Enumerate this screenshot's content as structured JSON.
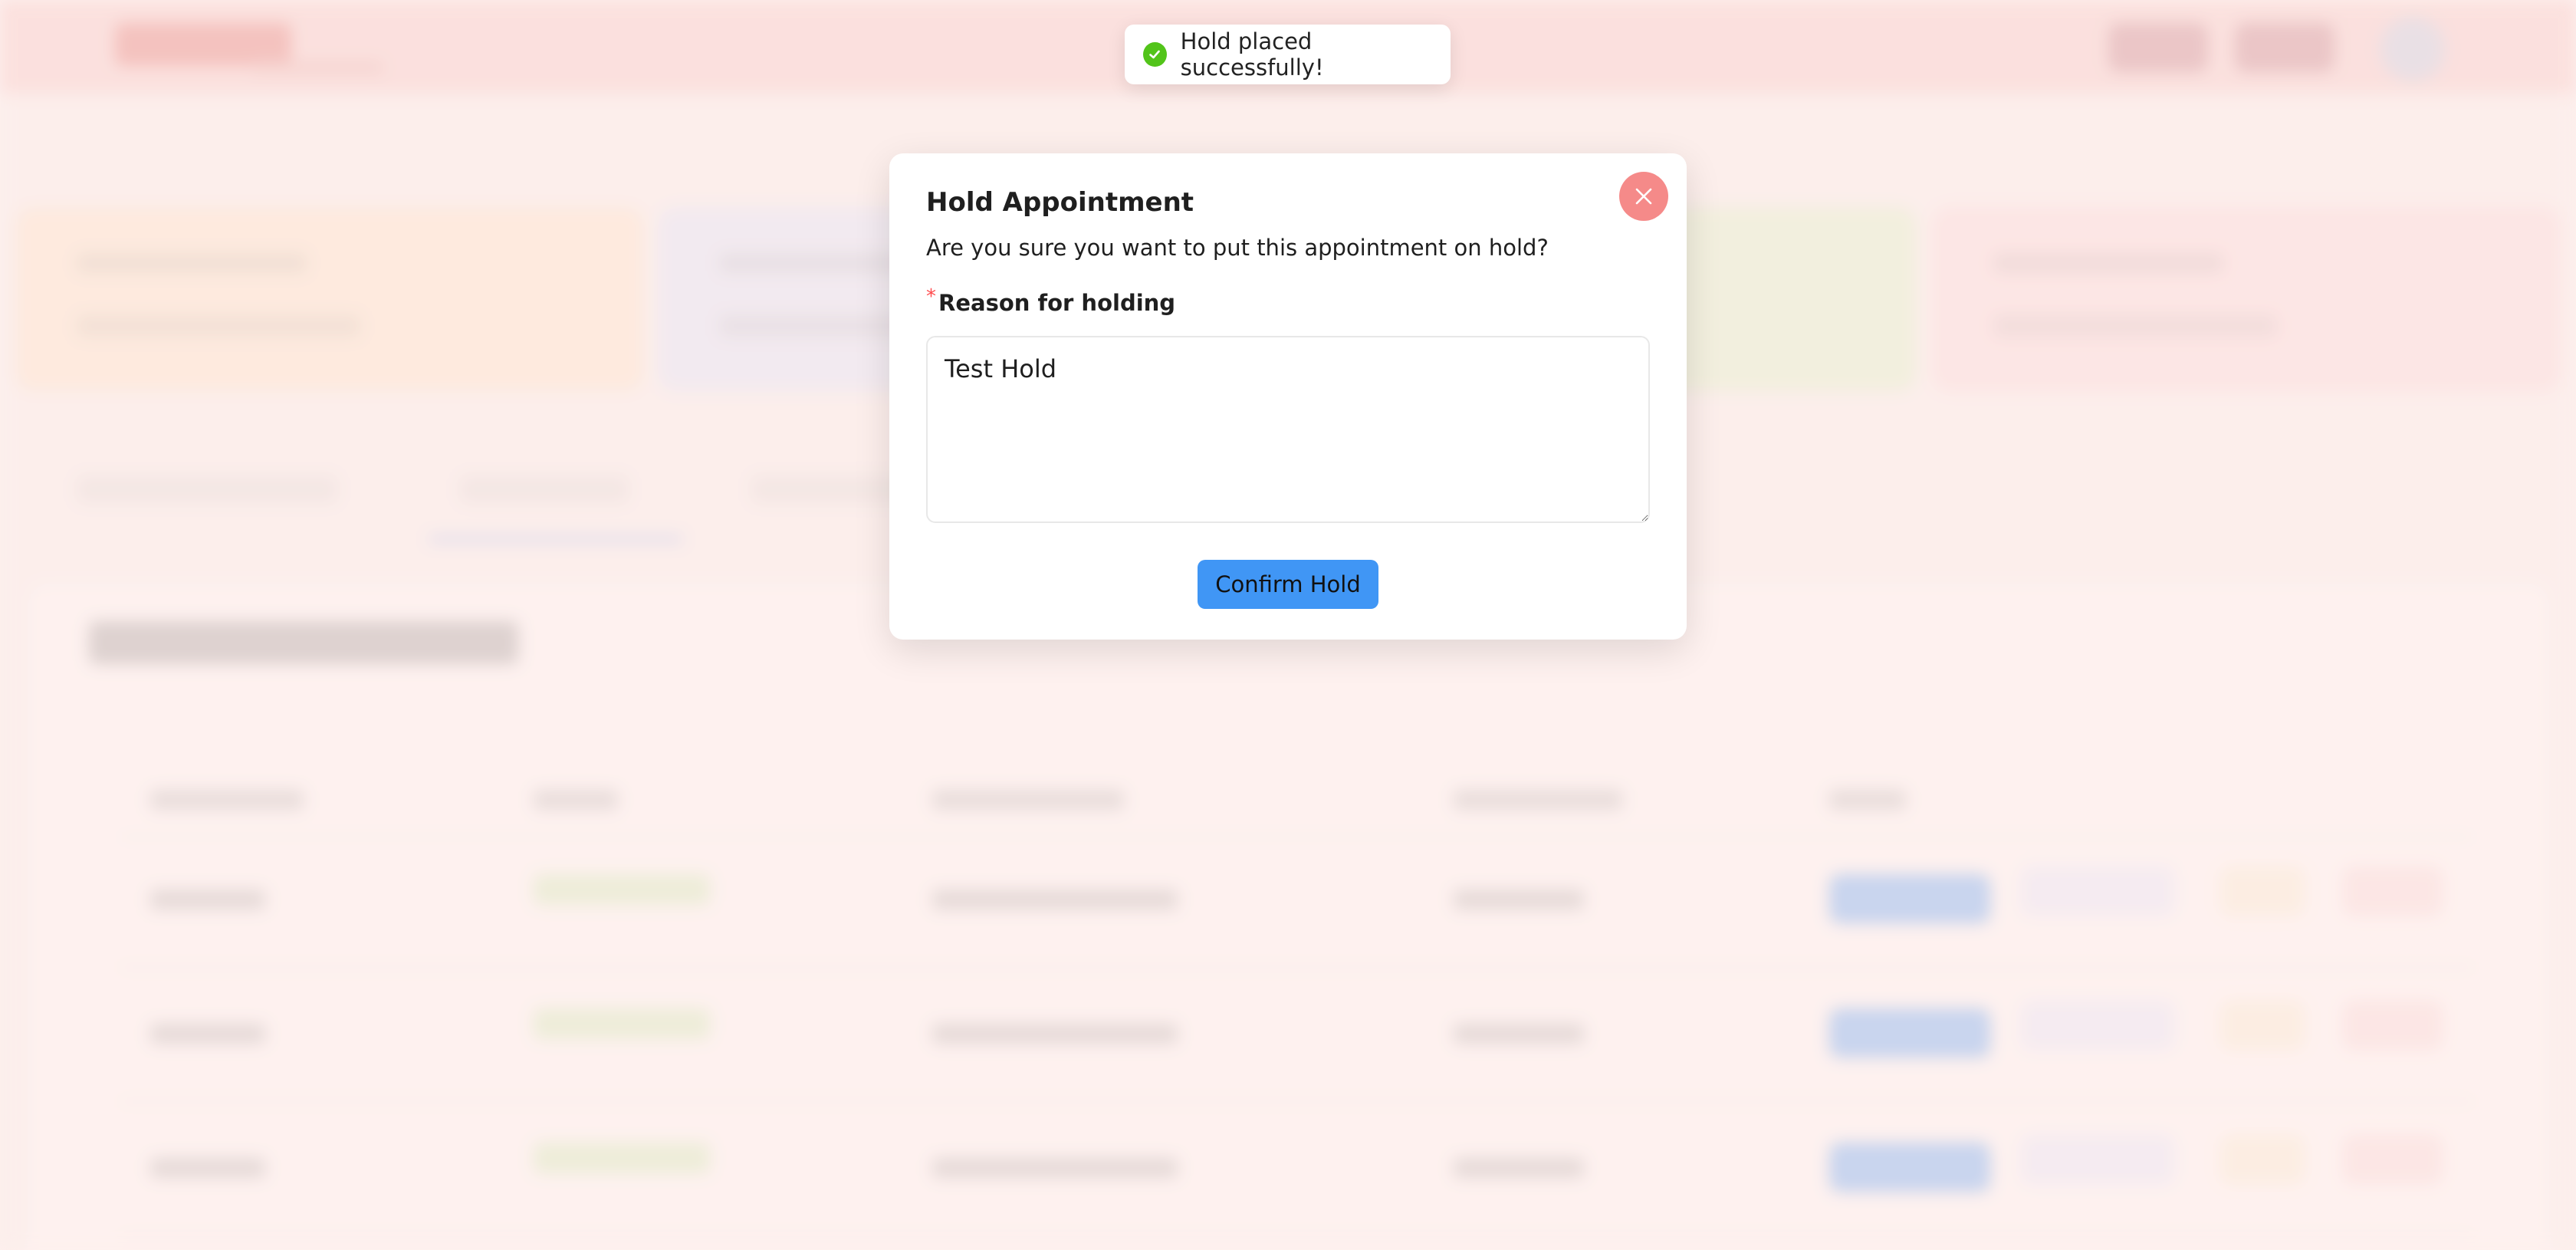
{
  "toast": {
    "message": "Hold placed successfully!",
    "icon": "check-circle-icon",
    "color": "#52c41a"
  },
  "modal": {
    "title": "Hold Appointment",
    "question": "Are you sure you want to put this appointment on hold?",
    "required_marker": "*",
    "field_label": "Reason for holding",
    "reason_value": "Test Hold",
    "confirm_label": "Confirm Hold",
    "close_icon": "close-icon",
    "colors": {
      "confirm": "#4096f5",
      "close": "#f58a89",
      "required": "#ff4d4f"
    }
  },
  "background": {
    "colors": {
      "topbar": "#f6c9c6",
      "stat_cards": [
        "#fde3c7",
        "#dfe3f7",
        "#e9efd7",
        "#dff0c6",
        "#fbd7d8"
      ],
      "status_badge": "#d2ecb9",
      "primary_action": "#6aa7f2"
    }
  }
}
